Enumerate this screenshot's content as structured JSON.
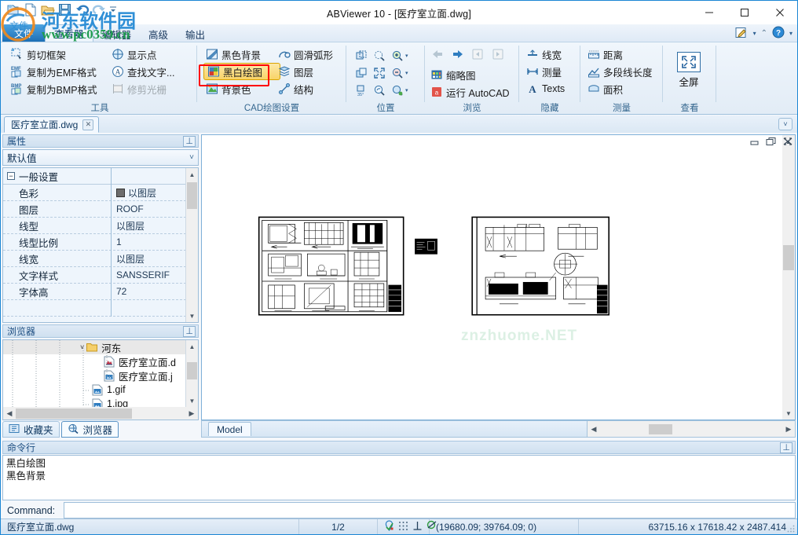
{
  "window": {
    "title": "ABViewer 10 - [医疗室立面.dwg]",
    "minimize": "–",
    "maximize": "□",
    "close": "✕"
  },
  "quick_access": {
    "items": [
      {
        "name": "app-menu-icon",
        "label": ""
      },
      {
        "name": "new-icon",
        "label": ""
      },
      {
        "name": "open-icon",
        "label": ""
      },
      {
        "name": "save-icon",
        "label": ""
      },
      {
        "name": "undo-icon",
        "label": ""
      },
      {
        "name": "redo-icon",
        "label": ""
      },
      {
        "name": "customize-qat-icon",
        "label": "▾"
      }
    ]
  },
  "ribbon": {
    "app_tab": "文件",
    "tabs": [
      {
        "label": "查看器",
        "active": true
      },
      {
        "label": "编辑器",
        "active": false
      },
      {
        "label": "高级",
        "active": false
      },
      {
        "label": "输出",
        "active": false
      }
    ],
    "help_zone": [
      {
        "name": "edit-style-icon",
        "label": "▾"
      },
      {
        "name": "minimize-ribbon-icon",
        "label": "⌃"
      },
      {
        "name": "help-icon",
        "label": "?"
      },
      {
        "name": "help-dropdown-icon",
        "label": "▾"
      }
    ],
    "groups": [
      {
        "name": "tools",
        "label": "工具",
        "columns": [
          [
            {
              "label": "剪切框架",
              "icon": "crop-frame-icon",
              "disabled": false
            },
            {
              "label": "复制为EMF格式",
              "icon": "copy-emf-icon",
              "disabled": false
            },
            {
              "label": "复制为BMP格式",
              "icon": "copy-bmp-icon",
              "disabled": false
            }
          ],
          [
            {
              "label": "显示点",
              "icon": "show-points-icon",
              "disabled": false
            },
            {
              "label": "查找文字...",
              "icon": "find-text-icon",
              "disabled": false
            },
            {
              "label": "修剪光栅",
              "icon": "trim-raster-icon",
              "disabled": true
            }
          ]
        ]
      },
      {
        "name": "cad-drawing-settings",
        "label": "CAD绘图设置",
        "columns": [
          [
            {
              "label": "黑色背景",
              "icon": "black-background-icon",
              "disabled": false
            },
            {
              "label": "黑白绘图",
              "icon": "monochrome-drawing-icon",
              "disabled": false,
              "highlighted": true
            },
            {
              "label": "背景色",
              "icon": "background-color-icon",
              "disabled": false
            }
          ],
          [
            {
              "label": "圆滑弧形",
              "icon": "smooth-arcs-icon",
              "disabled": false
            },
            {
              "label": "图层",
              "icon": "layers-icon",
              "disabled": false
            },
            {
              "label": "结构",
              "icon": "structure-icon",
              "disabled": false
            }
          ]
        ]
      },
      {
        "name": "position",
        "label": "位置",
        "columns": [
          [
            {
              "label": "",
              "icon": "pan-previous-icon",
              "disabled": false
            },
            {
              "label": "",
              "icon": "pan-icon",
              "disabled": false
            },
            {
              "label": "",
              "icon": "rotate-35-icon",
              "disabled": false
            }
          ],
          [
            {
              "label": "",
              "icon": "zoom-window-icon",
              "disabled": false
            },
            {
              "label": "",
              "icon": "zoom-fit-icon",
              "disabled": false
            },
            {
              "label": "",
              "icon": "zoom-realtime-icon",
              "disabled": false
            }
          ],
          [
            {
              "label": "",
              "icon": "zoom-in-icon",
              "disabled": false,
              "dropdown": true
            },
            {
              "label": "",
              "icon": "zoom-out-icon",
              "disabled": false,
              "dropdown": true
            },
            {
              "label": "",
              "icon": "zoom-select-icon",
              "disabled": false,
              "dropdown": true
            }
          ]
        ]
      },
      {
        "name": "browse",
        "label": "浏览",
        "columns": [
          [
            {
              "label": "",
              "icon": "back-arrow-icon",
              "disabled": true
            },
            {
              "label": "缩略图",
              "icon": "thumbnails-icon",
              "disabled": false
            },
            {
              "label": "运行 AutoCAD",
              "icon": "run-autocad-icon",
              "disabled": false
            }
          ],
          [
            {
              "label": "",
              "icon": "forward-arrow-icon",
              "disabled": false
            },
            {
              "label": "",
              "icon": "prev-page-icon",
              "disabled": true
            },
            {
              "label": "",
              "icon": "next-page-icon",
              "disabled": true
            }
          ]
        ]
      },
      {
        "name": "hide",
        "label": "隐藏",
        "columns": [
          [
            {
              "label": "线宽",
              "icon": "lineweight-icon",
              "disabled": false
            },
            {
              "label": "测量",
              "icon": "measure-hide-icon",
              "disabled": false
            },
            {
              "label": "Texts",
              "icon": "texts-icon",
              "disabled": false
            }
          ]
        ]
      },
      {
        "name": "measure",
        "label": "测量",
        "columns": [
          [
            {
              "label": "距离",
              "icon": "distance-icon",
              "disabled": false
            },
            {
              "label": "多段线长度",
              "icon": "polyline-length-icon",
              "disabled": false
            },
            {
              "label": "面积",
              "icon": "area-icon",
              "disabled": false
            }
          ]
        ]
      },
      {
        "name": "view",
        "label": "查看",
        "big_button": {
          "label": "全屏",
          "icon": "fullscreen-icon"
        }
      }
    ]
  },
  "document_tab": {
    "label": "医疗室立面.dwg",
    "close": "✕",
    "collapse": "˅"
  },
  "properties_panel": {
    "caption": "属性",
    "pin": "⊥",
    "selector_value": "默认值",
    "selector_arrow": "˅",
    "group_header": "一般设置",
    "expander": "−",
    "rows": [
      {
        "name": "色彩",
        "value": "以图层",
        "has_swatch": true,
        "swatch_color": "#6d6d6d"
      },
      {
        "name": "图层",
        "value": "ROOF",
        "has_swatch": false
      },
      {
        "name": "线型",
        "value": "以图层",
        "has_swatch": false
      },
      {
        "name": "线型比例",
        "value": "1",
        "has_swatch": false
      },
      {
        "name": "线宽",
        "value": "以图层",
        "has_swatch": false
      },
      {
        "name": "文字样式",
        "value": "SANSSERIF",
        "has_swatch": false
      },
      {
        "name": "字体高",
        "value": "72",
        "has_swatch": false
      }
    ]
  },
  "browser_panel": {
    "caption": "浏览器",
    "pin": "⊥",
    "tree": [
      {
        "label": "河东",
        "icon": "folder-icon",
        "indent": 3,
        "selected": true,
        "expander": "˅"
      },
      {
        "label": "医疗室立面.d",
        "icon": "dwg-file-icon",
        "indent": 4,
        "selected": false
      },
      {
        "label": "医疗室立面.j",
        "icon": "image-file-icon",
        "indent": 4,
        "selected": false
      },
      {
        "label": "1.gif",
        "icon": "image-file-icon",
        "indent": 3,
        "selected": false
      },
      {
        "label": "1.jpg",
        "icon": "image-file-icon",
        "indent": 3,
        "selected": false
      }
    ],
    "tabs": [
      {
        "label": "收藏夹",
        "icon": "favorites-icon",
        "active": false
      },
      {
        "label": "浏览器",
        "icon": "browser-icon",
        "active": true
      }
    ]
  },
  "canvas": {
    "mdi_buttons": [
      {
        "name": "mdi-minimize-icon",
        "glyph": "▭"
      },
      {
        "name": "mdi-restore-icon",
        "glyph": "❐"
      },
      {
        "name": "mdi-close-icon",
        "glyph": "✕"
      }
    ],
    "watermark": "znzhuome.NET",
    "model_tab": "Model",
    "heart_button": "♡"
  },
  "command_line": {
    "caption": "命令行",
    "pin": "⊥",
    "history": [
      "黑白绘图",
      "黑色背景"
    ],
    "prompt_label": "Command:",
    "input_value": "",
    "input_placeholder": ""
  },
  "status_bar": {
    "file_name": "医疗室立面.dwg",
    "page": "1/2",
    "snap_icons": [
      {
        "name": "osnap-icon"
      },
      {
        "name": "grid-icon"
      },
      {
        "name": "ortho-icon"
      },
      {
        "name": "polar-icon"
      }
    ],
    "coordinates": "(19680.09; 39764.09; 0)",
    "extents": "63715.16 x 17618.42 x 2487.414"
  },
  "colors": {
    "accent": "#1b86d4",
    "ribbon_bg": "#e9f2fa",
    "highlight": "#f8d367",
    "red_box": "#ff0000",
    "group_label": "#35678f"
  }
}
